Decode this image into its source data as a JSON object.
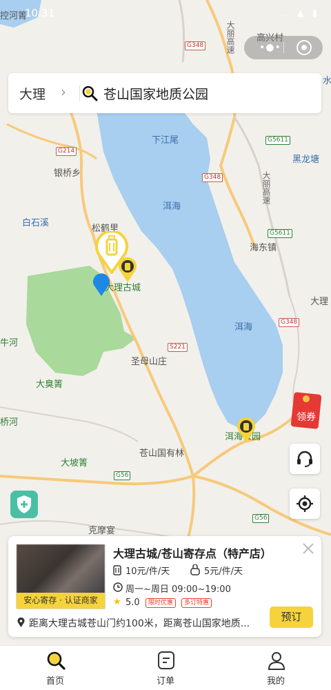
{
  "status_bar": {
    "time": "10:31"
  },
  "search": {
    "city": "大理",
    "query": "苍山国家地质公园"
  },
  "map_labels": {
    "kongheqing": "控河箐",
    "gaoxingcun": "高兴村",
    "xiajiangwei": "下江尾",
    "heilongtang": "黑龙塘",
    "yinqiaoxiang": "银桥乡",
    "erhai1": "洱海",
    "baishixi": "白石溪",
    "songhe": "松鹤里",
    "haidongzhen": "海东镇",
    "daligucheng": "大理古城",
    "dali_right": "大理",
    "erhai2": "洱海",
    "niuhe": "牛河",
    "shengmushanzhuang": "圣母山庄",
    "dachouqing": "大臭箐",
    "qiaohe": "桥河",
    "erhaigongyuan": "洱海公园",
    "cangshanyoulin": "苍山国有林",
    "dapoqing": "大坡箐",
    "kemoyan": "克摩宴",
    "shui": "水",
    "daliexpress1": "大丽高速",
    "daliexpress2": "大丽高速"
  },
  "road_shields": {
    "g348_top": "G348",
    "g214": "G214",
    "g5611_top": "G5611",
    "g348_mid": "G348",
    "g5611_mid": "G5611",
    "g348_right": "G348",
    "s221": "S221",
    "g56_left": "G56",
    "g56_right": "G56"
  },
  "coupon": {
    "label": "领券"
  },
  "card": {
    "badge": "安心寄存 · 认证商家",
    "title": "大理古城/苍山寄存点（特产店）",
    "price_large": "10元/件/天",
    "price_small": "5元/件/天",
    "hours": "周一~周日 09:00~19:00",
    "rating": "5.0",
    "tag1": "限时优惠",
    "tag2": "多订特惠",
    "book_label": "预订",
    "address": "距离大理古城苍山门约100米，距离苍山国家地质..."
  },
  "tabs": [
    {
      "label": "首页"
    },
    {
      "label": "订单"
    },
    {
      "label": "我的"
    }
  ],
  "colors": {
    "accent": "#f5d33c",
    "lake": "#a8cef0",
    "park": "#a9d99b",
    "road": "#f7c97a"
  }
}
